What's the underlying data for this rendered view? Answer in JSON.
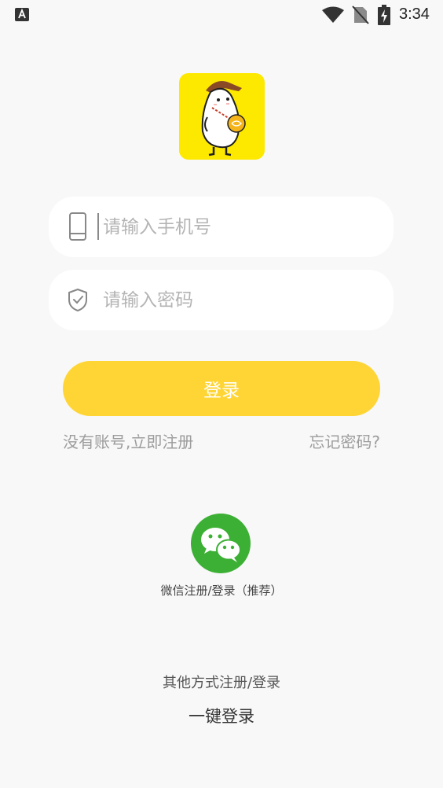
{
  "status_bar": {
    "notification_icon": "a-letter-icon",
    "icons": [
      "wifi-icon",
      "no-sim-icon",
      "battery-charging-icon"
    ],
    "time": "3:34"
  },
  "logo": {
    "icon": "cartoon-mascot-logo",
    "background_color": "#fde800"
  },
  "form": {
    "phone": {
      "icon": "phone-icon",
      "placeholder": "请输入手机号"
    },
    "password": {
      "icon": "shield-check-icon",
      "placeholder": "请输入密码"
    },
    "login_button": {
      "label": "登录",
      "color": "#ffd535"
    },
    "register_link": "没有账号,立即注册",
    "forgot_link": "忘记密码?"
  },
  "wechat": {
    "icon": "wechat-icon",
    "label": "微信注册/登录（推荐）",
    "color": "#3cb034"
  },
  "other": {
    "title": "其他方式注册/登录",
    "one_click_label": "一键登录"
  }
}
